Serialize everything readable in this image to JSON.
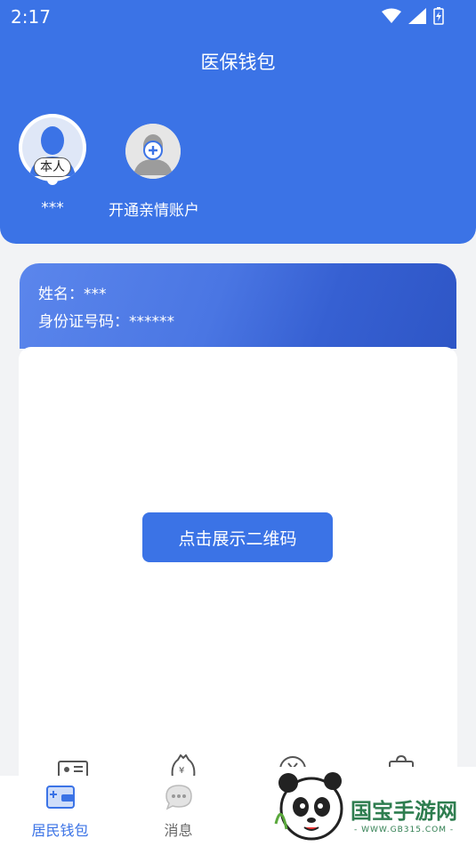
{
  "status": {
    "time": "2:17"
  },
  "header": {
    "title": "医保钱包"
  },
  "members": [
    {
      "name": "***",
      "badge": "本人"
    },
    {
      "name": "开通亲情账户"
    }
  ],
  "card": {
    "name_label": "姓名：",
    "name_value": "***",
    "id_label": "身份证号码：",
    "id_value": "******"
  },
  "qr": {
    "button_label": "点击展示二维码"
  },
  "tabs": [
    {
      "label": "居民钱包",
      "active": true,
      "icon": "wallet-icon"
    },
    {
      "label": "消息",
      "active": false,
      "icon": "message-icon"
    }
  ],
  "watermark": {
    "text": "国宝手游网",
    "url": "- WWW.GB315.COM -"
  },
  "colors": {
    "primary": "#3b73e6",
    "background": "#f2f3f5"
  }
}
